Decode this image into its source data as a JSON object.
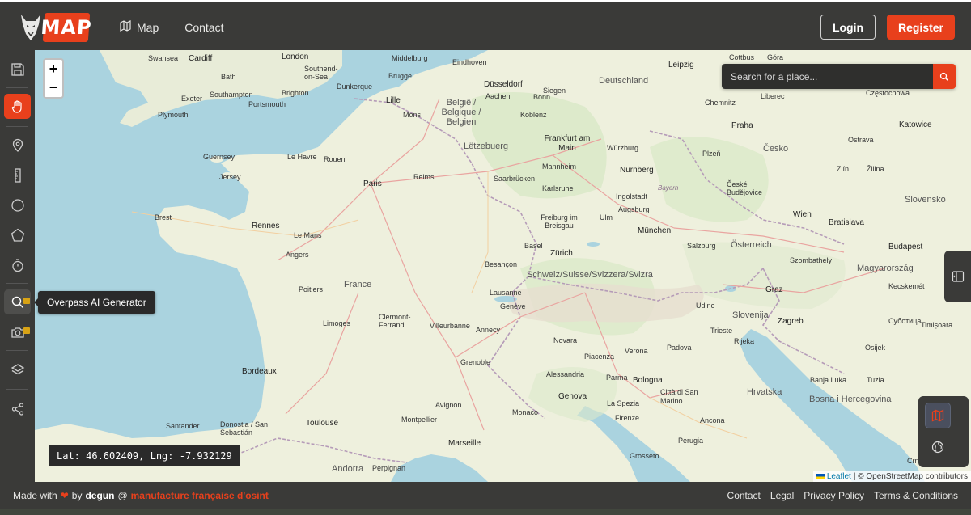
{
  "header": {
    "logo_text": "MAP",
    "nav": [
      {
        "label": "Map",
        "icon": "map-icon"
      },
      {
        "label": "Contact",
        "icon": ""
      }
    ],
    "login_label": "Login",
    "register_label": "Register"
  },
  "sidebar": {
    "tools": [
      {
        "name": "save",
        "icon": "save-icon"
      },
      {
        "name": "hand",
        "icon": "hand-icon",
        "active": true
      },
      {
        "name": "marker",
        "icon": "map-pin-icon"
      },
      {
        "name": "measure",
        "icon": "ruler-icon"
      },
      {
        "name": "circle",
        "icon": "circle-icon"
      },
      {
        "name": "polygon",
        "icon": "polygon-icon"
      },
      {
        "name": "timer",
        "icon": "stopwatch-icon"
      },
      {
        "name": "overpass",
        "icon": "search-icon",
        "premium": true
      },
      {
        "name": "camera",
        "icon": "camera-icon",
        "premium": true
      },
      {
        "name": "layers",
        "icon": "layers-icon"
      },
      {
        "name": "share",
        "icon": "share-icon"
      }
    ]
  },
  "map": {
    "zoom_in": "+",
    "zoom_out": "−",
    "search_placeholder": "Search for a place...",
    "tooltip": "Overpass AI Generator",
    "coords": "Lat: 46.602409, Lng: -7.932129",
    "attribution_leaflet": "Leaflet",
    "attribution_osm": "| © OpenStreetMap contributors",
    "labels": {
      "swansea": "Swansea",
      "cardiff": "Cardiff",
      "london": "London",
      "middelburg": "Middelburg",
      "eindhoven": "Eindhoven",
      "leipzig": "Leipzig",
      "cottbus": "Cottbus",
      "gora": "Góra",
      "bath": "Bath",
      "southend": "Southend-on-Sea",
      "dusseldorf": "Düsseldorf",
      "bruges": "Brugge",
      "dunkerque": "Dunkerque",
      "aachen": "Aachen",
      "siegen": "Siegen",
      "deutschland": "Deutschland",
      "exeter": "Exeter",
      "southampton": "Southampton",
      "brighton": "Brighton",
      "lille": "Lille",
      "bonn": "Bonn",
      "chemnitz": "Chemnitz",
      "liberec": "Liberec",
      "czestochowa": "Częstochowa",
      "portsmouth": "Portsmouth",
      "plymouth": "Plymouth",
      "belgique": "België / Belgique / Belgien",
      "mons": "Mons",
      "koblenz": "Koblenz",
      "frankfurt": "Frankfurt am Main",
      "praha": "Praha",
      "katowice": "Katowice",
      "letzebuerg": "Lëtzebuerg",
      "wurzburg": "Würzburg",
      "plzen": "Plzeň",
      "cesko": "Česko",
      "ostrava": "Ostrava",
      "guernsey": "Guernsey",
      "lehavre": "Le Havre",
      "rouen": "Rouen",
      "jersey": "Jersey",
      "reims": "Reims",
      "mannheim": "Mannheim",
      "nurnberg": "Nürnberg",
      "saarbrucken": "Saarbrücken",
      "zlin": "Zlín",
      "zilina": "Žilina",
      "karlsruhe": "Karlsruhe",
      "paris": "Paris",
      "ingolstadt": "Ingolstadt",
      "bayern": "Bayern",
      "ceske": "České Budějovice",
      "slovensko": "Slovensko",
      "brest": "Brest",
      "augsburg": "Augsburg",
      "ulm": "Ulm",
      "wien": "Wien",
      "bratislava": "Bratislava",
      "freiburg": "Freiburg im Breisgau",
      "munchen": "München",
      "rennes": "Rennes",
      "lemans": "Le Mans",
      "basel": "Basel",
      "salzburg": "Salzburg",
      "osterreich": "Österreich",
      "budapest": "Budapest",
      "angers": "Angers",
      "zurich": "Zürich",
      "szombathely": "Szombathely",
      "magyarorszag": "Magyarország",
      "besancon": "Besançon",
      "schweiz": "Schweiz/Suisse/Svizzera/Svizra",
      "lausanne": "Lausanne",
      "poitiers": "Poitiers",
      "france": "France",
      "graz": "Graz",
      "kecskemet": "Kecskemét",
      "geneve": "Genève",
      "udine": "Udine",
      "slovenija": "Slovenija",
      "subotica": "Суботица",
      "limoges": "Limoges",
      "clermont": "Clermont-Ferrand",
      "villeurbanne": "Villeurbanne",
      "annecy": "Annecy",
      "verona": "Verona",
      "padova": "Padova",
      "zagreb": "Zagreb",
      "timisoara": "Timișoara",
      "trieste": "Trieste",
      "rijeka": "Rijeka",
      "osijek": "Osijek",
      "bordeaux": "Bordeaux",
      "novara": "Novara",
      "piacenza": "Piacenza",
      "grenoble": "Grenoble",
      "parma": "Parma",
      "bologna": "Bologna",
      "alessandria": "Alessandria",
      "hrvatska": "Hrvatska",
      "banjaluka": "Banja Luka",
      "tuzla": "Tuzla",
      "genova": "Genova",
      "cittasm": "Città di San Marino",
      "avignon": "Avignon",
      "monaco": "Monaco",
      "laspezia": "La Spezia",
      "bosna": "Bosna i Hercegovina",
      "toulouse": "Toulouse",
      "montpellier": "Montpellier",
      "firenze": "Firenze",
      "ancona": "Ancona",
      "santander": "Santander",
      "donostia": "Donostia / San Sebastián",
      "marseille": "Marseille",
      "perugia": "Perugia",
      "andorra": "Andorra",
      "perpignan": "Perpignan",
      "grosseto": "Grosseto",
      "cronagora": "Crna Gora"
    }
  },
  "footer": {
    "made_with": "Made with",
    "heart": "❤",
    "by": "by",
    "author": "degun",
    "at": "@",
    "brand": "manufacture française d'osint",
    "links": [
      "Contact",
      "Legal",
      "Privacy Policy",
      "Terms & Conditions"
    ]
  }
}
